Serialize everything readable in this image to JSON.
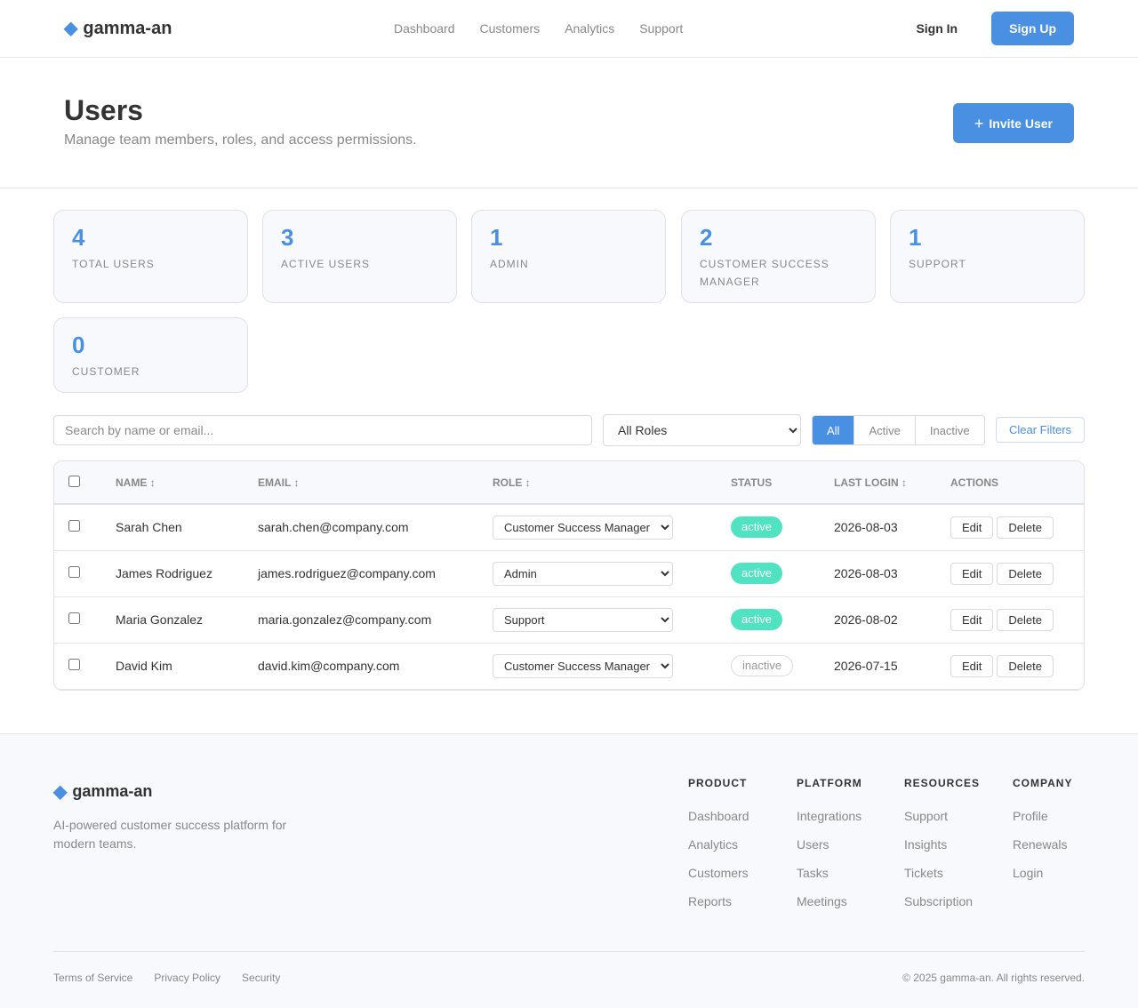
{
  "header": {
    "logo_mark": "◆",
    "logo_text": "gamma-an",
    "nav": [
      "Dashboard",
      "Customers",
      "Analytics",
      "Support"
    ],
    "sign_in": "Sign In",
    "sign_up": "Sign Up"
  },
  "page": {
    "title": "Users",
    "subtitle": "Manage team members, roles, and access permissions.",
    "invite_icon": "+",
    "invite_label": "Invite User"
  },
  "stats": [
    {
      "value": "4",
      "label": "Total Users"
    },
    {
      "value": "3",
      "label": "Active Users"
    },
    {
      "value": "1",
      "label": "Admin"
    },
    {
      "value": "2",
      "label": "Customer Success Manager"
    },
    {
      "value": "1",
      "label": "Support"
    },
    {
      "value": "0",
      "label": "Customer"
    }
  ],
  "filters": {
    "search_placeholder": "Search by name or email...",
    "role_selected": "All Roles",
    "status_tabs": [
      "All",
      "Active",
      "Inactive"
    ],
    "status_active": "All",
    "clear_label": "Clear Filters"
  },
  "table": {
    "headers": {
      "name": "Name ↕",
      "email": "Email ↕",
      "role": "Role ↕",
      "status": "Status",
      "last_login": "Last Login ↕",
      "actions": "Actions"
    },
    "rows": [
      {
        "name": "Sarah Chen",
        "email": "sarah.chen@company.com",
        "role": "Customer Success Manager",
        "status": "active",
        "last_login": "2026-08-03"
      },
      {
        "name": "James Rodriguez",
        "email": "james.rodriguez@company.com",
        "role": "Admin",
        "status": "active",
        "last_login": "2026-08-03"
      },
      {
        "name": "Maria Gonzalez",
        "email": "maria.gonzalez@company.com",
        "role": "Support",
        "status": "active",
        "last_login": "2026-08-02"
      },
      {
        "name": "David Kim",
        "email": "david.kim@company.com",
        "role": "Customer Success Manager",
        "status": "inactive",
        "last_login": "2026-07-15"
      }
    ],
    "edit_label": "Edit",
    "delete_label": "Delete"
  },
  "footer": {
    "logo_mark": "◆",
    "logo_text": "gamma-an",
    "tagline": "AI-powered customer success platform for modern teams.",
    "columns": [
      {
        "title": "Product",
        "links": [
          "Dashboard",
          "Analytics",
          "Customers",
          "Reports"
        ]
      },
      {
        "title": "Platform",
        "links": [
          "Integrations",
          "Users",
          "Tasks",
          "Meetings"
        ]
      },
      {
        "title": "Resources",
        "links": [
          "Support",
          "Insights",
          "Tickets",
          "Subscription"
        ]
      },
      {
        "title": "Company",
        "links": [
          "Profile",
          "Renewals",
          "Login"
        ]
      }
    ],
    "legal": [
      "Terms of Service",
      "Privacy Policy",
      "Security"
    ],
    "copyright": "© 2025 gamma-an. All rights reserved."
  },
  "colors": {
    "accent": "#4a90e2",
    "status_active": "#50e3c2"
  }
}
